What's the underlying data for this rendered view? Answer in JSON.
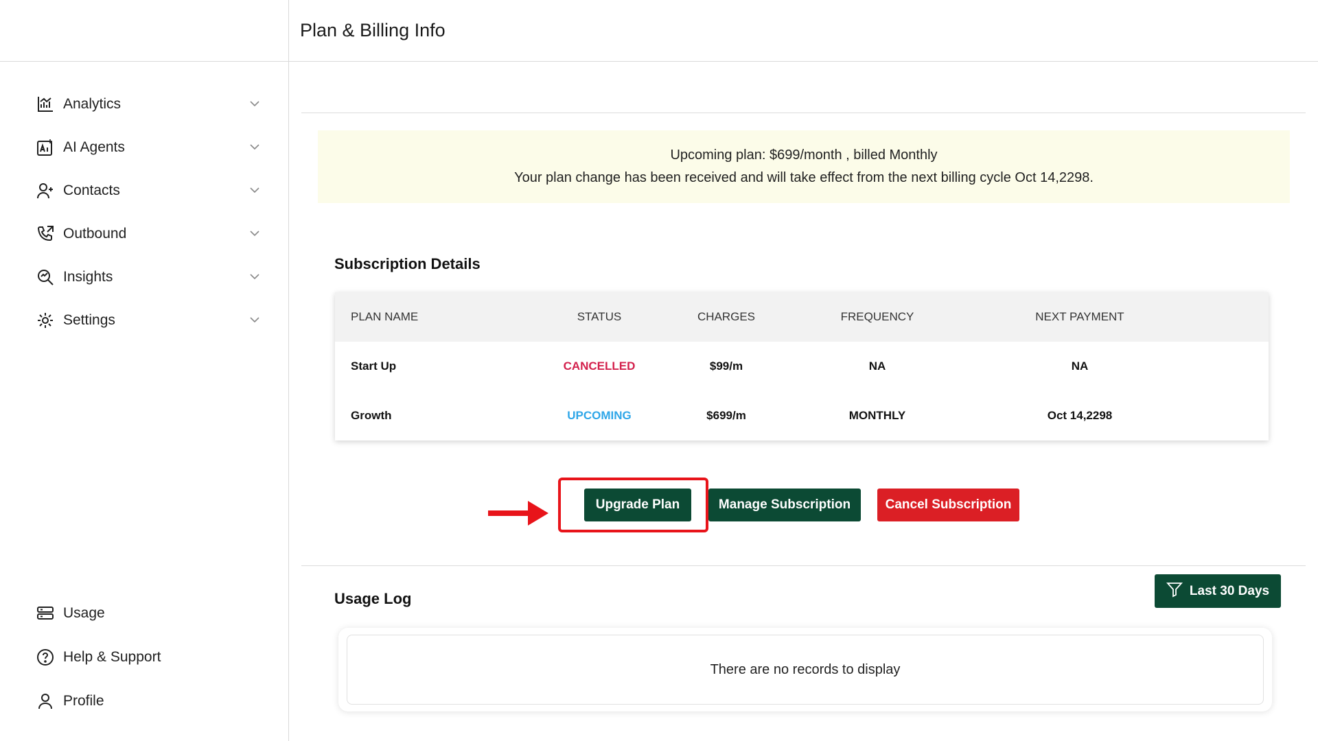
{
  "header": {
    "title": "Plan & Billing Info"
  },
  "sidebar": {
    "items": [
      {
        "label": "Analytics",
        "icon": "analytics-icon"
      },
      {
        "label": "AI Agents",
        "icon": "ai-agents-icon"
      },
      {
        "label": "Contacts",
        "icon": "contacts-icon"
      },
      {
        "label": "Outbound",
        "icon": "outbound-icon"
      },
      {
        "label": "Insights",
        "icon": "insights-icon"
      },
      {
        "label": "Settings",
        "icon": "settings-icon"
      }
    ],
    "bottom_items": [
      {
        "label": "Usage",
        "icon": "usage-icon"
      },
      {
        "label": "Help & Support",
        "icon": "help-icon"
      },
      {
        "label": "Profile",
        "icon": "profile-icon"
      }
    ]
  },
  "notice": {
    "line1": "Upcoming plan: $699/month , billed Monthly",
    "line2": "Your plan change has been received and will take effect from the next billing cycle Oct 14,2298."
  },
  "subscription": {
    "title": "Subscription Details",
    "columns": [
      "PLAN NAME",
      "STATUS",
      "CHARGES",
      "FREQUENCY",
      "NEXT PAYMENT"
    ],
    "rows": [
      {
        "plan": "Start Up",
        "status": "CANCELLED",
        "charges": "$99/m",
        "frequency": "NA",
        "next_payment": "NA"
      },
      {
        "plan": "Growth",
        "status": "UPCOMING",
        "charges": "$699/m",
        "frequency": "MONTHLY",
        "next_payment": "Oct 14,2298"
      }
    ]
  },
  "actions": {
    "upgrade_label": "Upgrade Plan",
    "manage_label": "Manage Subscription",
    "cancel_label": "Cancel Subscription"
  },
  "usage_log": {
    "title": "Usage Log",
    "filter_label": "Last 30 Days",
    "empty_text": "There are no records to display"
  },
  "colors": {
    "primary": "#0c4a34",
    "danger": "#db1f25",
    "cancelled": "#d3204c",
    "upcoming": "#2ea6e8",
    "notice_bg": "#fcfce9",
    "highlight": "#e8141a"
  }
}
